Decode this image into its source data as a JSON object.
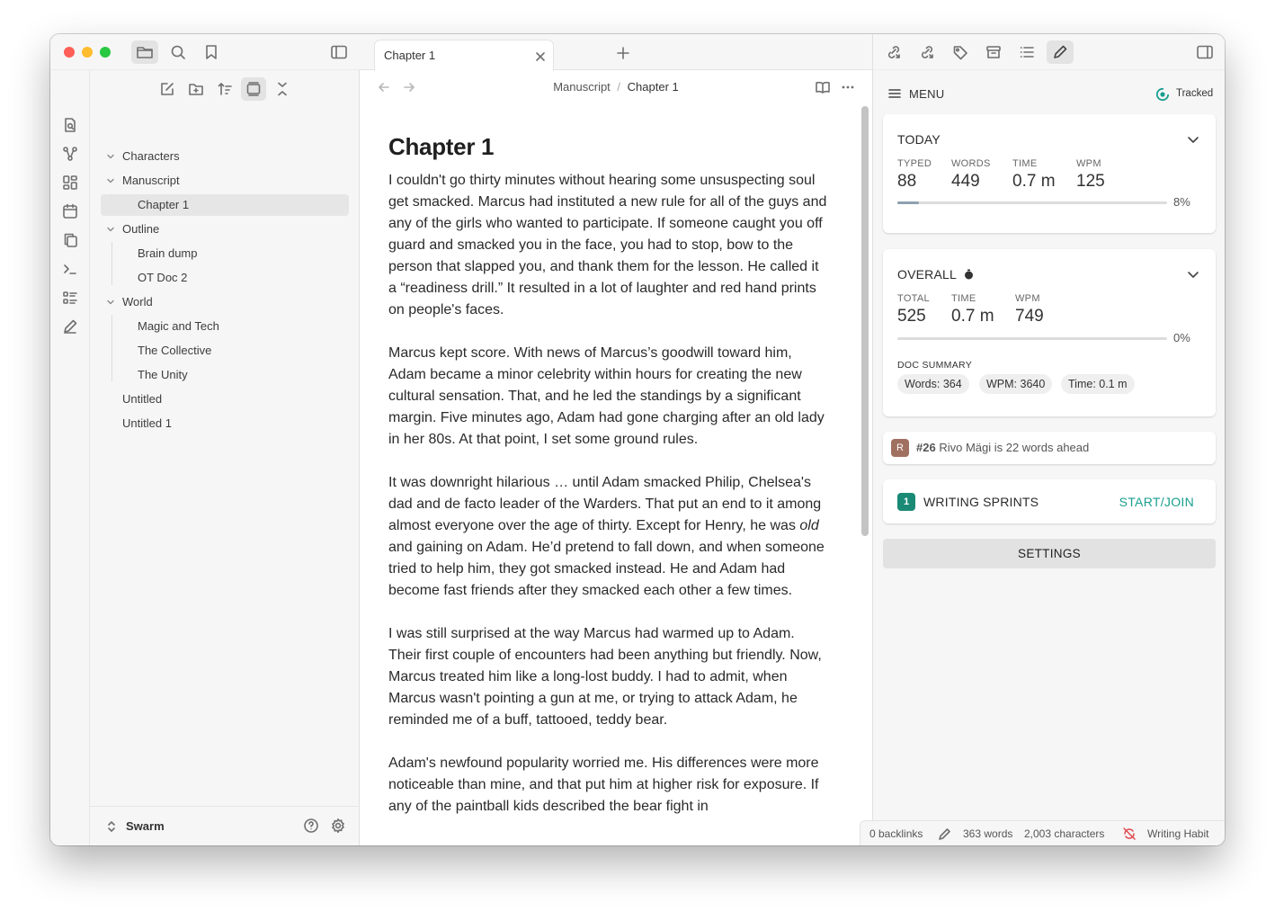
{
  "sidebar": {
    "tree": [
      {
        "label": "Characters",
        "level": 0,
        "collapsible": true
      },
      {
        "label": "Manuscript",
        "level": 0,
        "collapsible": true
      },
      {
        "label": "Chapter 1",
        "level": 1,
        "active": true
      },
      {
        "label": "Outline",
        "level": 0,
        "collapsible": true
      },
      {
        "label": "Brain dump",
        "level": 1
      },
      {
        "label": "OT Doc 2",
        "level": 1
      },
      {
        "label": "World",
        "level": 0,
        "collapsible": true
      },
      {
        "label": "Magic and Tech",
        "level": 1
      },
      {
        "label": "The Collective",
        "level": 1
      },
      {
        "label": "The Unity",
        "level": 1
      },
      {
        "label": "Untitled",
        "level": 0
      },
      {
        "label": "Untitled 1",
        "level": 0
      }
    ],
    "vault_name": "Swarm"
  },
  "tab": {
    "title": "Chapter 1"
  },
  "breadcrumb": {
    "parent": "Manuscript",
    "separator": "/",
    "current": "Chapter 1"
  },
  "editor": {
    "heading": "Chapter 1",
    "p1": "I couldn't go thirty minutes without hearing some unsuspecting soul get smacked. Marcus had instituted a new rule for all of the guys and any of the girls who wanted to participate. If someone caught you off guard and smacked you in the face, you had to stop, bow to the person that slapped you, and thank them for the lesson. He called it a “readiness drill.” It resulted in a lot of laughter and red hand prints on people's faces.",
    "p2": "Marcus kept score. With news of Marcus’s goodwill toward him, Adam became a minor celebrity within hours for creating the new cultural sensation. That, and he led the standings by a significant margin. Five minutes ago, Adam had gone charging after an old lady in her 80s. At that point, I set some ground rules.",
    "p3a": "It was downright hilarious …  until Adam smacked Philip, Chelsea's dad and de facto leader of the Warders. That put an end to it among almost everyone over the age of thirty. Except for Henry, he was ",
    "p3em": "old",
    "p3b": " and gaining on Adam. He’d pretend to fall down, and when someone tried to help him, they got smacked instead. He and Adam had become fast friends after they smacked each other a few times.",
    "p4": "I was still surprised at the way Marcus had warmed up to Adam. Their first couple of encounters had been anything but friendly. Now, Marcus treated him like a long-lost buddy. I had to admit, when Marcus wasn't pointing a gun at me, or trying to attack Adam, he reminded me of a buff, tattooed, teddy bear.",
    "p5": "Adam's newfound popularity worried me. His differences were more noticeable than mine, and that put him at higher risk for exposure. If any of the paintball kids described the bear fight in"
  },
  "status": {
    "backlinks": "0 backlinks",
    "words": "363 words",
    "characters": "2,003 characters",
    "plugin": "Writing Habit"
  },
  "panel": {
    "menu_label": "MENU",
    "tracked_label": "Tracked",
    "accent": "#1a9e8f",
    "today": {
      "title": "TODAY",
      "stats": [
        {
          "label": "TYPED",
          "value": "88"
        },
        {
          "label": "WORDS",
          "value": "449"
        },
        {
          "label": "TIME",
          "value": "0.7 m"
        },
        {
          "label": "WPM",
          "value": "125"
        }
      ],
      "progress": 8,
      "progress_label": "8%"
    },
    "overall": {
      "title": "OVERALL",
      "stats": [
        {
          "label": "TOTAL",
          "value": "525"
        },
        {
          "label": "TIME",
          "value": "0.7 m"
        },
        {
          "label": "WPM",
          "value": "749"
        }
      ],
      "progress": 0,
      "progress_label": "0%",
      "summary_title": "DOC SUMMARY",
      "chips": [
        "Words: 364",
        "WPM: 3640",
        "Time: 0.1 m"
      ]
    },
    "leaderboard": {
      "avatar": "R",
      "rank": "#26",
      "text": "Rivo Mägi is 22 words ahead"
    },
    "sprints": {
      "badge": "1",
      "title": "WRITING SPRINTS",
      "action": "START/JOIN"
    },
    "settings_label": "SETTINGS"
  }
}
